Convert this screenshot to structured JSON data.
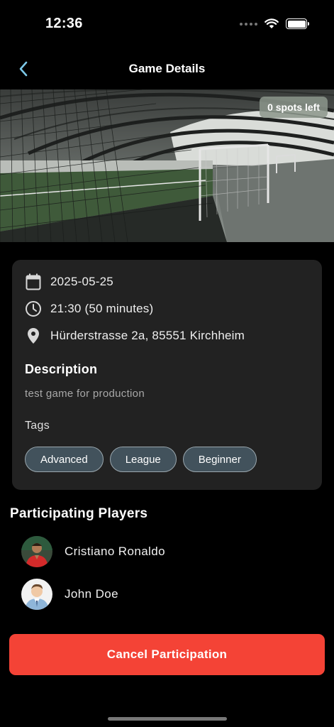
{
  "status_bar": {
    "time": "12:36"
  },
  "nav": {
    "title": "Game Details",
    "back_icon": "chevron-left-icon"
  },
  "hero": {
    "spots_badge": "0 spots left"
  },
  "details": {
    "date": "2025-05-25",
    "time": "21:30 (50 minutes)",
    "location": "Hürderstrasse 2a, 85551 Kirchheim",
    "description_heading": "Description",
    "description": "test game for production",
    "tags_heading": "Tags",
    "tags": [
      "Advanced",
      "League",
      "Beginner"
    ]
  },
  "players": {
    "heading": "Participating Players",
    "list": [
      {
        "name": "Cristiano Ronaldo"
      },
      {
        "name": "John Doe"
      }
    ]
  },
  "actions": {
    "cancel_label": "Cancel Participation"
  },
  "colors": {
    "accent": "#f44336",
    "card": "#222222",
    "tag_bg": "#42525c",
    "back_icon": "#7cc8e8"
  }
}
